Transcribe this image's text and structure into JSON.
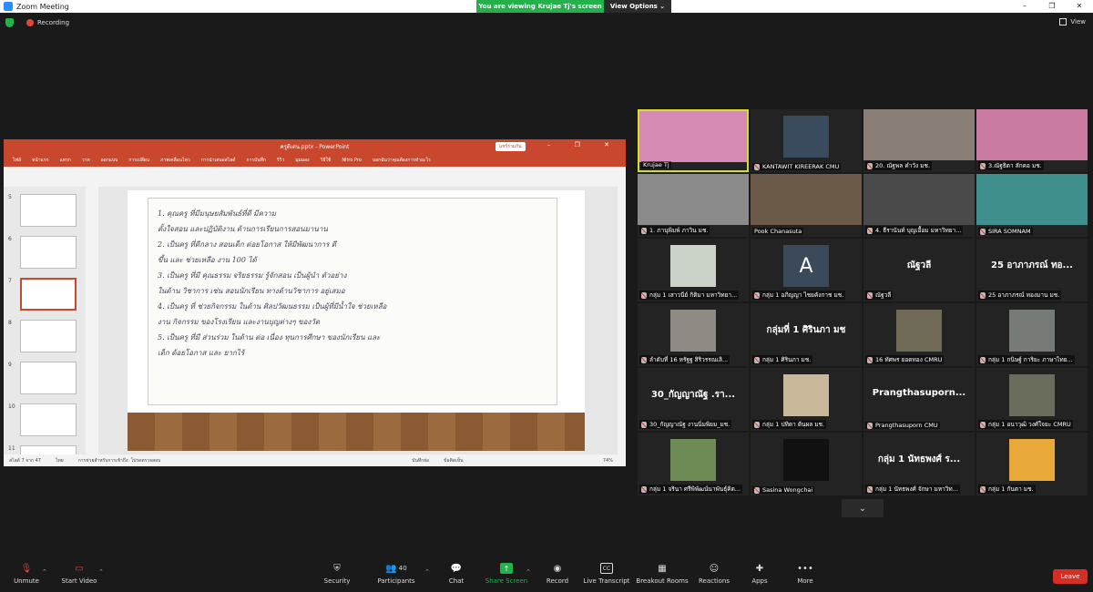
{
  "window": {
    "title": "Zoom Meeting",
    "minimize": "–",
    "maximize": "❐",
    "close": "✕"
  },
  "banner": {
    "viewing": "You are viewing Krujae Tj's screen",
    "view_options": "View Options ⌄"
  },
  "status": {
    "recording": "Recording",
    "view": "View"
  },
  "ppt": {
    "title": "ครูดีเด่น.pptx - PowerPoint",
    "share_btn": "แชร์ร่วมกัน",
    "menu": [
      "ไฟล์",
      "หน้าแรก",
      "แทรก",
      "วาด",
      "ออกแบบ",
      "การเปลี่ยน",
      "ภาพเคลื่อนไหว",
      "การนำเสนอสไลด์",
      "การบันทึก",
      "รีวิว",
      "มุมมอง",
      "วิธีใช้",
      "Nitro Pro",
      "บอกฉันว่าคุณต้องการทำอะไร"
    ],
    "thumb_numbers": [
      "5",
      "6",
      "7",
      "8",
      "9",
      "10",
      "11"
    ],
    "handwriting": [
      "1. คุณครู ที่มีมนุษยสัมพันธ์ที่ดี มีความ",
      "ตั้งใจสอน และปฏิบัติงาน ด้านการเรียนการสอนมานาน",
      "2. เป็นครู ที่ดีกลาง สอนเด็ก ต่อยโอกาส ให้มีพัฒนาการ ดี",
      "ขึ้น และ ช่วยเหลือ งาน 100 ได้",
      "3. เป็นครู ที่มี คุณธรรม จริยธรรม รู้จักสอน เป็นผู้นำ ตัวอย่าง",
      "ในด้าน วิชาการ เช่น สอนนักเรียน ทางด้านวิชาการ อยู่เสมอ",
      "4. เป็นครู ที่ ช่วยกิจกรรม ในด้าน ศิลปวัฒนธรรม เป็นผู้ที่มีน้ำใจ ช่วยเหลือ",
      "งาน กิจกรรม ของโรงเรียน และงานบุญต่างๆ ของวัด",
      "5. เป็นครู ที่มี ส่วนร่วม ในด้าน ต่อ เนื่อง ทุนการศึกษา ของนักเรียน และ",
      "เด็ก ด้อยโอกาส และ ยากไร้"
    ],
    "status_left": "สไลด์ 7 จาก 47",
    "status_lang": "ไทย",
    "status_access": "การช่วยสำหรับการเข้าถึง: โปรดตรวจสอบ",
    "status_notes": "บันทึกย่อ",
    "status_comments": "ข้อคิดเห็น",
    "zoom": "74%"
  },
  "participants": [
    {
      "name": "Krujae Tj",
      "muted": false,
      "kind": "video",
      "color": "#d68bb4",
      "active": true
    },
    {
      "name": "KANTAWIT KIREERAK CMU",
      "muted": true,
      "kind": "photo",
      "color": "#3b4b5e"
    },
    {
      "name": "20. ณัฐพล คำวัง มช.",
      "muted": true,
      "kind": "video",
      "color": "#8a7f77"
    },
    {
      "name": "3.ณัฐธิดา สักคอ มช.",
      "muted": true,
      "kind": "video",
      "color": "#c97aa0"
    },
    {
      "name": "1. ภานุพิมพ์ ภาวิน มช.",
      "muted": true,
      "kind": "video",
      "color": "#8b8b8b"
    },
    {
      "name": "Pook Chanasuta",
      "muted": false,
      "kind": "video",
      "color": "#6b5a48"
    },
    {
      "name": "4. ธีรานันท์ บุญเอื้อม มหาวิทยา...",
      "muted": true,
      "kind": "video",
      "color": "#4a4a4a"
    },
    {
      "name": "SIRA SOMNAM",
      "muted": true,
      "kind": "video",
      "color": "#3f8f8f"
    },
    {
      "name": "กลุ่ม 1 เสาวนีย์ กิติมา มหาวิทยา...",
      "muted": true,
      "kind": "photo",
      "color": "#cbd3c8"
    },
    {
      "name": "กลุ่ม 1 อภิญญา ไชยคังกาช มช.",
      "muted": true,
      "kind": "avatar",
      "letter": "A",
      "color": "#3a4a5a"
    },
    {
      "name": "ณัฐวลี",
      "muted": true,
      "kind": "name",
      "big": "ณัฐวลี",
      "color": "#232323"
    },
    {
      "name": "25 อาภาภรณ์ ทองมาน มช.",
      "muted": true,
      "kind": "name",
      "big": "25 อาภาภรณ์ ทอ...",
      "color": "#232323"
    },
    {
      "name": "ลำดับที่ 16 หรัฐฐ สิริวรรณเลิ...",
      "muted": true,
      "kind": "photo",
      "color": "#8f8a83"
    },
    {
      "name": "กลุ่ม 1 ศิรินภา มช.",
      "muted": true,
      "kind": "name",
      "big": "กลุ่มที่ 1 ศิรินภา มช",
      "color": "#232323"
    },
    {
      "name": "16 ทัศพร ยอดทอง CMRU",
      "muted": true,
      "kind": "photo",
      "color": "#6f6a55"
    },
    {
      "name": "กลุ่ม 1 กนิษฐ์ การิยะ ภาษาไทย...",
      "muted": true,
      "kind": "photo",
      "color": "#777b77"
    },
    {
      "name": "30_กัญญาณัฐ งานนิ่มพิยม_มช.",
      "muted": true,
      "kind": "name",
      "big": "30_กัญญาณัฐ .รา...",
      "color": "#232323"
    },
    {
      "name": "กลุ่ม 1 ปทิตา ต้นผล มช.",
      "muted": true,
      "kind": "photo",
      "color": "#c9b99a"
    },
    {
      "name": "Prangthasuporn CMU",
      "muted": true,
      "kind": "name",
      "big": "Prangthasuporn...",
      "color": "#232323"
    },
    {
      "name": "กลุ่ม 1 อนาวุฒิ วงศ์ใจยะ CMRU",
      "muted": true,
      "kind": "photo",
      "color": "#6b6d5c"
    },
    {
      "name": "กลุ่ม 1 จรินา ศรีพิพัฒน์นาพันธุ์คิต...",
      "muted": true,
      "kind": "photo",
      "color": "#6e8a55"
    },
    {
      "name": "Sasina Wongchai",
      "muted": true,
      "kind": "blank",
      "color": "#111111"
    },
    {
      "name": "กลุ่ม 1 นัทธพงศ์ จักษา มหาวิท...",
      "muted": true,
      "kind": "name",
      "big": "กลุ่ม 1 นัทธพงศ์ ร...",
      "color": "#232323"
    },
    {
      "name": "กลุ่ม 1 กันตา มช.",
      "muted": true,
      "kind": "photo",
      "color": "#e9a93a"
    }
  ],
  "toolbar": {
    "unmute": "Unmute",
    "start_video": "Start Video",
    "security": "Security",
    "participants": "Participants",
    "participants_count": "40",
    "chat": "Chat",
    "share_screen": "Share Screen",
    "record": "Record",
    "live_transcript": "Live Transcript",
    "breakout_rooms": "Breakout Rooms",
    "reactions": "Reactions",
    "apps": "Apps",
    "more": "More",
    "leave": "Leave",
    "cc": "CC"
  }
}
